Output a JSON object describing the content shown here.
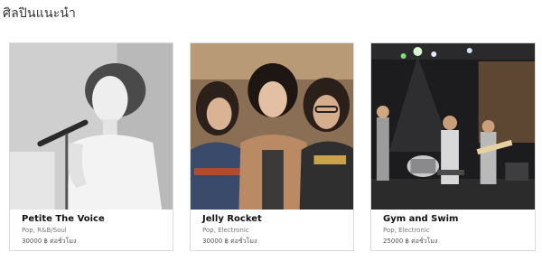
{
  "section": {
    "title": "ศิลปินแนะนำ"
  },
  "artists": [
    {
      "name": "Petite The Voice",
      "genre": "Pop, R&B/Soul",
      "price": "30000 ฿ ต่อชั่วโมง"
    },
    {
      "name": "Jelly Rocket",
      "genre": "Pop, Electronic",
      "price": "30000 ฿ ต่อชั่วโมง"
    },
    {
      "name": "Gym and Swim",
      "genre": "Pop, Electronic",
      "price": "25000 ฿ ต่อชั่วโมง"
    }
  ]
}
